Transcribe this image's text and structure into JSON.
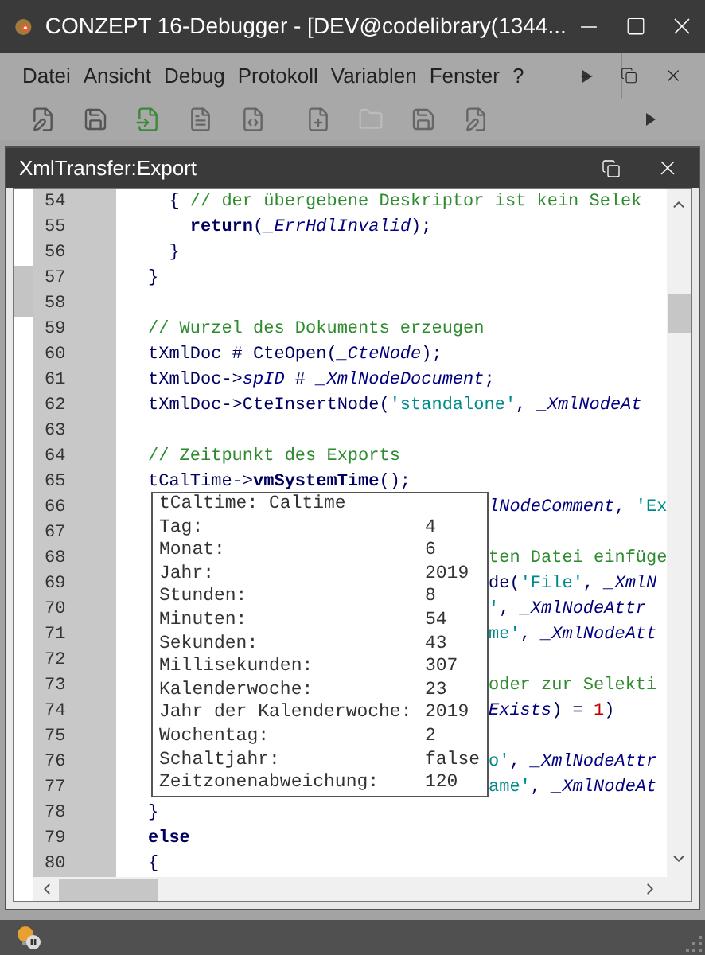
{
  "window": {
    "title": "CONZEPT 16-Debugger - [DEV@codelibrary(1344..."
  },
  "menu": [
    "Datei",
    "Ansicht",
    "Debug",
    "Protokoll",
    "Variablen",
    "Fenster",
    "?"
  ],
  "document": {
    "title": "XmlTransfer:Export",
    "lines": [
      {
        "number": "54",
        "marked": false,
        "tokens": [
          {
            "kind": "plain",
            "text": "  { "
          },
          {
            "kind": "comment",
            "text": "// der übergebene Deskriptor ist kein Selek"
          }
        ]
      },
      {
        "number": "55",
        "marked": false,
        "tokens": [
          {
            "kind": "keyword",
            "text": "    return"
          },
          {
            "kind": "plain",
            "text": "("
          },
          {
            "kind": "constant",
            "text": "_ErrHdlInvalid"
          },
          {
            "kind": "plain",
            "text": ");"
          }
        ]
      },
      {
        "number": "56",
        "marked": false,
        "tokens": [
          {
            "kind": "plain",
            "text": "  }"
          }
        ]
      },
      {
        "number": "57",
        "marked": true,
        "tokens": [
          {
            "kind": "plain",
            "text": "}"
          }
        ]
      },
      {
        "number": "58",
        "marked": true
      },
      {
        "number": "59",
        "marked": false,
        "tokens": [
          {
            "kind": "comment",
            "text": "// Wurzel des Dokuments erzeugen"
          }
        ]
      },
      {
        "number": "60",
        "marked": false,
        "tokens": [
          {
            "kind": "plain",
            "text": "tXmlDoc # CteOpen("
          },
          {
            "kind": "constant",
            "text": "_CteNode"
          },
          {
            "kind": "plain",
            "text": ");"
          }
        ]
      },
      {
        "number": "61",
        "marked": false,
        "tokens": [
          {
            "kind": "plain",
            "text": "tXmlDoc->"
          },
          {
            "kind": "constant",
            "text": "spID"
          },
          {
            "kind": "plain",
            "text": " # "
          },
          {
            "kind": "constant",
            "text": "_XmlNodeDocument"
          },
          {
            "kind": "plain",
            "text": ";"
          }
        ]
      },
      {
        "number": "62",
        "marked": false,
        "tokens": [
          {
            "kind": "plain",
            "text": "tXmlDoc->CteInsertNode("
          },
          {
            "kind": "string",
            "text": "'standalone'"
          },
          {
            "kind": "plain",
            "text": ", "
          },
          {
            "kind": "constant",
            "text": "_XmlNodeAt"
          }
        ]
      },
      {
        "number": "63",
        "marked": false
      },
      {
        "number": "64",
        "marked": false,
        "tokens": [
          {
            "kind": "comment",
            "text": "// Zeitpunkt des Exports"
          }
        ]
      },
      {
        "number": "65",
        "marked": false,
        "tokens": [
          {
            "kind": "plain",
            "text": "tCalTime->"
          },
          {
            "kind": "keyword",
            "text": "vmSystemTime"
          },
          {
            "kind": "plain",
            "text": "();"
          }
        ]
      },
      {
        "number": "66",
        "marked": false,
        "tail_tokens": [
          {
            "kind": "constant",
            "text": "lNodeComment"
          },
          {
            "kind": "plain",
            "text": ", "
          },
          {
            "kind": "string",
            "text": "'Ex"
          }
        ]
      },
      {
        "number": "67",
        "marked": false
      },
      {
        "number": "68",
        "marked": false,
        "tail_tokens": [
          {
            "kind": "comment",
            "text": "ten Datei einfüge"
          }
        ]
      },
      {
        "number": "69",
        "marked": false,
        "tail_tokens": [
          {
            "kind": "plain",
            "text": "de("
          },
          {
            "kind": "string",
            "text": "'File'"
          },
          {
            "kind": "plain",
            "text": ", "
          },
          {
            "kind": "constant",
            "text": "_XmlN"
          }
        ]
      },
      {
        "number": "70",
        "marked": false,
        "tail_tokens": [
          {
            "kind": "string",
            "text": "'"
          },
          {
            "kind": "plain",
            "text": ", "
          },
          {
            "kind": "constant",
            "text": "_XmlNodeAttr"
          }
        ]
      },
      {
        "number": "71",
        "marked": false,
        "tail_tokens": [
          {
            "kind": "string",
            "text": "me'"
          },
          {
            "kind": "plain",
            "text": ", "
          },
          {
            "kind": "constant",
            "text": "_XmlNodeAtt"
          }
        ]
      },
      {
        "number": "72",
        "marked": false
      },
      {
        "number": "73",
        "marked": false,
        "tail_tokens": [
          {
            "kind": "comment",
            "text": "oder zur Selekti"
          }
        ]
      },
      {
        "number": "74",
        "marked": false,
        "tail_tokens": [
          {
            "kind": "constant",
            "text": "Exists"
          },
          {
            "kind": "plain",
            "text": ") = "
          },
          {
            "kind": "number",
            "text": "1"
          },
          {
            "kind": "plain",
            "text": ")"
          }
        ]
      },
      {
        "number": "75",
        "marked": false
      },
      {
        "number": "76",
        "marked": false,
        "tail_tokens": [
          {
            "kind": "string",
            "text": "o'"
          },
          {
            "kind": "plain",
            "text": ", "
          },
          {
            "kind": "constant",
            "text": "_XmlNodeAttr"
          }
        ]
      },
      {
        "number": "77",
        "marked": false,
        "tail_tokens": [
          {
            "kind": "string",
            "text": "ame'"
          },
          {
            "kind": "plain",
            "text": ", "
          },
          {
            "kind": "constant",
            "text": "_XmlNodeAt"
          }
        ]
      },
      {
        "number": "78",
        "marked": false,
        "tokens": [
          {
            "kind": "plain",
            "text": "}"
          }
        ]
      },
      {
        "number": "79",
        "marked": false,
        "tokens": [
          {
            "kind": "keyword",
            "text": "else"
          }
        ]
      },
      {
        "number": "80",
        "marked": false,
        "tokens": [
          {
            "kind": "plain",
            "text": "{"
          }
        ]
      }
    ]
  },
  "tooltip": {
    "title": "tCaltime: Caltime",
    "rows": [
      {
        "label": "Tag:",
        "value": "4"
      },
      {
        "label": "Monat:",
        "value": "6"
      },
      {
        "label": "Jahr:",
        "value": "2019"
      },
      {
        "label": "Stunden:",
        "value": "8"
      },
      {
        "label": "Minuten:",
        "value": "54"
      },
      {
        "label": "Sekunden:",
        "value": "43"
      },
      {
        "label": "Millisekunden:",
        "value": "307"
      },
      {
        "label": "Kalenderwoche:",
        "value": "23"
      },
      {
        "label": "Jahr der Kalenderwoche:",
        "value": "2019"
      },
      {
        "label": "Wochentag:",
        "value": "2"
      },
      {
        "label": "Schaltjahr:",
        "value": "false"
      },
      {
        "label": "Zeitzonenabweichung:",
        "value": "120"
      }
    ]
  }
}
